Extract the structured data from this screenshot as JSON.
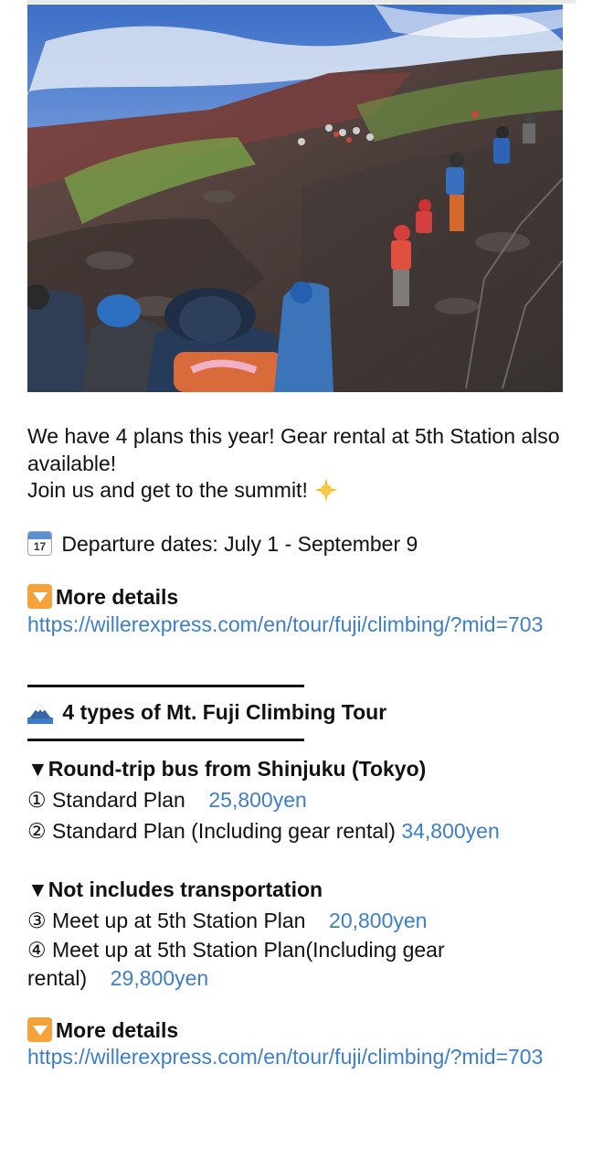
{
  "post": {
    "intro_line1": "We have 4 plans this year! Gear rental at 5th Station also available!",
    "intro_line2": "Join us and get to the summit!",
    "calendar_day": "17",
    "departure": "Departure dates: July 1 - September 9",
    "more_details_label": "More details",
    "details_url": "https://willerexpress.com/en/tour/fuji/climbing/?mid=703",
    "divider_text": "——————————",
    "tour_heading": "4 types of Mt. Fuji Climbing Tour",
    "section1_heading": "Round-trip bus from Shinjuku (Tokyo)",
    "section1_marker": "▼",
    "plans_bus": [
      {
        "number": "①",
        "name": "Standard Plan",
        "price": "25,800yen"
      },
      {
        "number": "②",
        "name": "Standard Plan (Including gear rental)",
        "price": "34,800yen"
      }
    ],
    "section2_heading": "Not includes transportation",
    "section2_marker": "▼",
    "plans_no_transport": [
      {
        "number": "③",
        "name": "Meet up at 5th Station Plan",
        "price": "20,800yen"
      },
      {
        "number": "④",
        "name": "Meet up at 5th Station Plan(Including gear rental)",
        "price": "29,800yen"
      }
    ],
    "more_details_label_2": "More details",
    "details_url_2": "https://willerexpress.com/en/tour/fuji/climbing/?mid=703"
  },
  "icons": {
    "sun": "sparkle-sun-icon",
    "calendar": "calendar-icon",
    "down_arrow": "down-arrow-button-icon",
    "mountain": "snow-mountain-icon"
  },
  "colors": {
    "link": "#3d7ec7",
    "text": "#111111",
    "arrow_box": "#f4a23a"
  }
}
